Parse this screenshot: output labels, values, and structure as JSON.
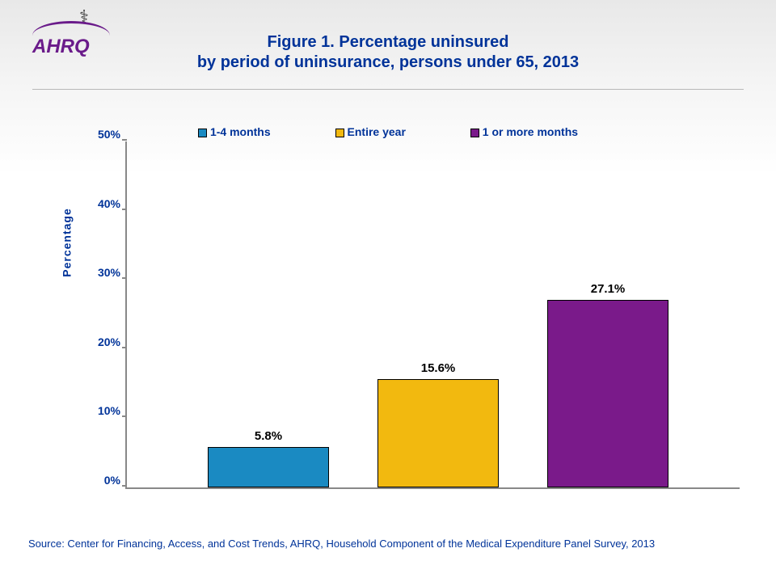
{
  "logo": {
    "text": "AHRQ"
  },
  "title_line1": "Figure 1. Percentage uninsured",
  "title_line2": "by period of uninsurance, persons under 65, 2013",
  "ylabel": "Percentage",
  "yticks": [
    "0%",
    "10%",
    "20%",
    "30%",
    "40%",
    "50%"
  ],
  "legend": [
    {
      "label": "1-4 months",
      "color": "#1a8ac2"
    },
    {
      "label": "Entire year",
      "color": "#f2b90f"
    },
    {
      "label": "1 or more months",
      "color": "#7a1a8a"
    }
  ],
  "bars": [
    {
      "label": "5.8%",
      "color": "#1a8ac2"
    },
    {
      "label": "15.6%",
      "color": "#f2b90f"
    },
    {
      "label": "27.1%",
      "color": "#7a1a8a"
    }
  ],
  "source": "Source: Center for Financing, Access, and Cost Trends, AHRQ, Household Component of the Medical Expenditure Panel Survey, 2013",
  "chart_data": {
    "type": "bar",
    "title": "Figure 1. Percentage uninsured by period of uninsurance, persons under 65, 2013",
    "xlabel": "",
    "ylabel": "Percentage",
    "ylim": [
      0,
      50
    ],
    "categories": [
      "1-4 months",
      "Entire year",
      "1 or more months"
    ],
    "values": [
      5.8,
      15.6,
      27.1
    ],
    "colors": [
      "#1a8ac2",
      "#f2b90f",
      "#7a1a8a"
    ]
  }
}
